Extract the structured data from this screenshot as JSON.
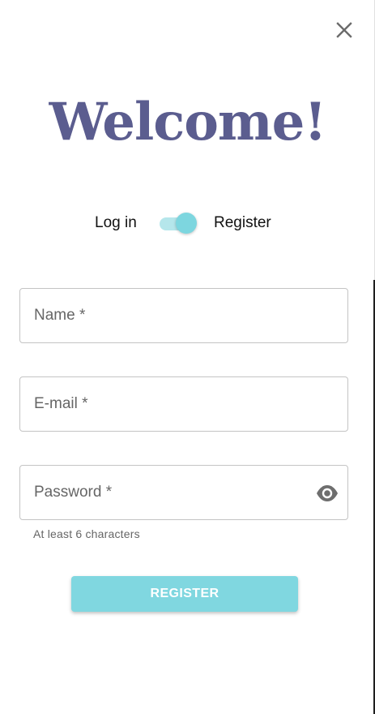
{
  "dialog": {
    "title": "Welcome!"
  },
  "mode_switch": {
    "left_label": "Log in",
    "right_label": "Register",
    "selected": "Register",
    "track_color": "#b5e6eb",
    "thumb_color": "#7dd6df"
  },
  "form": {
    "name_label": "Name *",
    "email_label": "E-mail *",
    "password_label": "Password *",
    "password_helper": "At least 6 characters",
    "submit_label": "REGISTER"
  },
  "icons": {
    "close": "close-icon",
    "password_visibility": "eye-icon"
  },
  "colors": {
    "title": "#5b5d8f",
    "accent": "#80d7e0"
  }
}
